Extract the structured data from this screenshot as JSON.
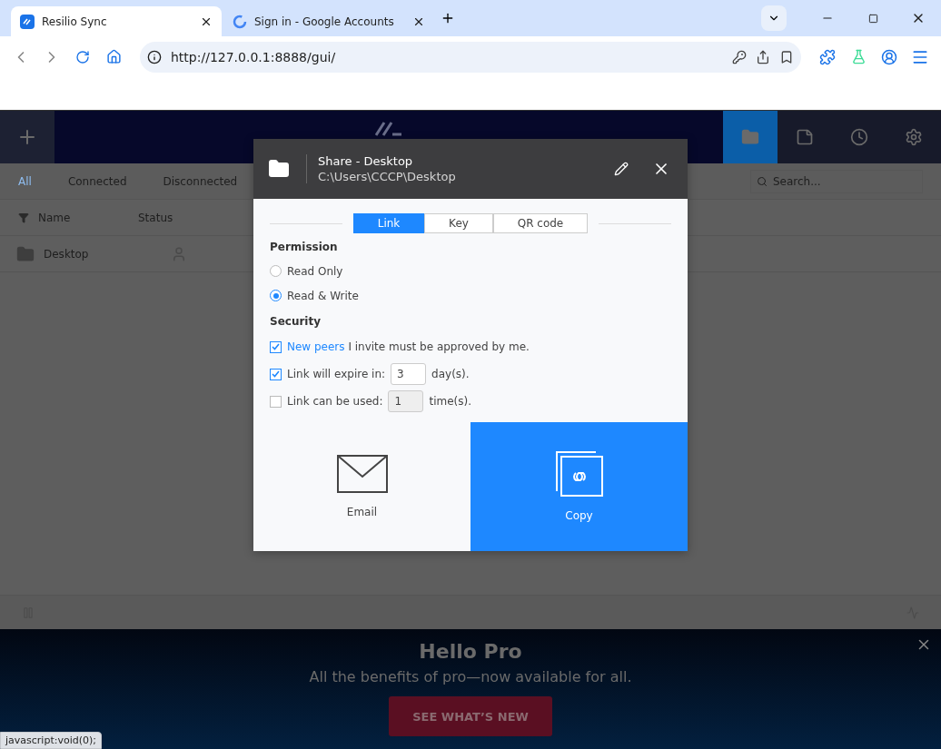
{
  "browser": {
    "tabs": [
      {
        "title": "Resilio Sync",
        "kind": "app",
        "selected": true
      },
      {
        "title": "Sign in - Google Accounts",
        "kind": "google",
        "selected": false
      }
    ],
    "url": "http://127.0.0.1:8888/gui/"
  },
  "app": {
    "nav": [
      {
        "kind": "folders",
        "selected": true
      },
      {
        "kind": "notes",
        "selected": false
      },
      {
        "kind": "history",
        "selected": false
      },
      {
        "kind": "settings",
        "selected": false
      }
    ],
    "filters": [
      {
        "label": "All",
        "selected": true
      },
      {
        "label": "Connected",
        "selected": false
      },
      {
        "label": "Disconnected",
        "selected": false
      }
    ],
    "search": {
      "placeholder": "Search..."
    },
    "columns": [
      "Name",
      "Status"
    ],
    "rows": [
      {
        "name": "Desktop"
      }
    ]
  },
  "dialog": {
    "title": "Share - Desktop",
    "path": "C:\\Users\\CCCP\\Desktop",
    "tabs": [
      {
        "label": "Link",
        "selected": true
      },
      {
        "label": "Key",
        "selected": false
      },
      {
        "label": "QR code",
        "selected": false
      }
    ],
    "permission": {
      "heading": "Permission",
      "options": [
        {
          "label": "Read Only",
          "selected": false
        },
        {
          "label": "Read & Write",
          "selected": true
        }
      ]
    },
    "security": {
      "heading": "Security",
      "options": [
        {
          "kind": "approval",
          "link": "New peers",
          "text": "I invite must be approved by me.",
          "checked": true
        },
        {
          "kind": "expire",
          "label": "Link will expire in:",
          "value": "3",
          "unit": "day(s).",
          "checked": true
        },
        {
          "kind": "uses",
          "label": "Link can be used:",
          "value": "1",
          "unit": "time(s).",
          "checked": false
        }
      ]
    },
    "actions": [
      {
        "kind": "email",
        "label": "Email",
        "selected": false
      },
      {
        "kind": "copy",
        "label": "Copy",
        "selected": true
      }
    ]
  },
  "promo": {
    "title": "Hello Pro",
    "text": "All the benefits of pro—now available for all.",
    "button": "SEE WHAT’S NEW"
  },
  "status_url": "javascript:void(0);"
}
